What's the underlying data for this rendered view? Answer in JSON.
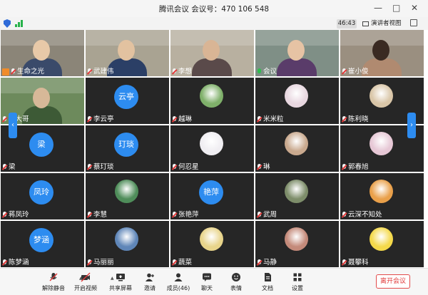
{
  "window": {
    "title": "腾讯会议 会议号：470 106 548",
    "minimize": "—",
    "maximize": "□",
    "close": "✕"
  },
  "infobar": {
    "timer": "46:43",
    "speaker_view": "演讲者视图"
  },
  "participants": [
    {
      "name": "生命之光",
      "kind": "video",
      "mic": "muted",
      "host": true
    },
    {
      "name": "武建伟",
      "kind": "video",
      "mic": "muted"
    },
    {
      "name": "李想",
      "kind": "video",
      "mic": "muted"
    },
    {
      "name": "会议",
      "kind": "video",
      "mic": "on"
    },
    {
      "name": "崔小俊",
      "kind": "video",
      "mic": "muted"
    },
    {
      "name": "田大哥",
      "kind": "video",
      "mic": "muted"
    },
    {
      "name": "李云亭",
      "kind": "text",
      "avatar_text": "云亭",
      "mic": "muted"
    },
    {
      "name": "越琳",
      "kind": "image",
      "mic": "muted"
    },
    {
      "name": "米米粒",
      "kind": "image",
      "mic": "muted"
    },
    {
      "name": "陈利晓",
      "kind": "image",
      "mic": "muted"
    },
    {
      "name": "梁",
      "kind": "text",
      "avatar_text": "梁",
      "mic": "muted"
    },
    {
      "name": "蔡玎琰",
      "kind": "text",
      "avatar_text": "玎琰",
      "mic": "muted"
    },
    {
      "name": "何忍星",
      "kind": "image",
      "mic": "muted"
    },
    {
      "name": "琳",
      "kind": "image",
      "mic": "muted"
    },
    {
      "name": "郭春旭",
      "kind": "image",
      "mic": "muted"
    },
    {
      "name": "蒋凤玲",
      "kind": "text",
      "avatar_text": "凤玲",
      "mic": "muted"
    },
    {
      "name": "李慧",
      "kind": "image",
      "mic": "muted"
    },
    {
      "name": "张艳萍",
      "kind": "text",
      "avatar_text": "艳萍",
      "mic": "muted"
    },
    {
      "name": "武周",
      "kind": "image",
      "mic": "muted"
    },
    {
      "name": "云深不知处",
      "kind": "image",
      "mic": "muted"
    },
    {
      "name": "陈梦涵",
      "kind": "text",
      "avatar_text": "梦涵",
      "mic": "muted"
    },
    {
      "name": "马丽丽",
      "kind": "image",
      "mic": "muted"
    },
    {
      "name": "蔬菜",
      "kind": "image",
      "mic": "muted"
    },
    {
      "name": "马静",
      "kind": "image",
      "mic": "muted"
    },
    {
      "name": "聂攀科",
      "kind": "image",
      "mic": "muted"
    }
  ],
  "pager": {
    "prev": "‹",
    "next": "›"
  },
  "toolbar": {
    "items": [
      {
        "label": "解除静音",
        "icon": "mic-muted-icon"
      },
      {
        "label": "开启视频",
        "icon": "camera-off-icon"
      },
      {
        "label": "共享屏幕",
        "icon": "share-screen-icon"
      },
      {
        "label": "邀请",
        "icon": "invite-icon"
      },
      {
        "label": "成员(46)",
        "icon": "members-icon"
      },
      {
        "label": "聊天",
        "icon": "chat-icon"
      },
      {
        "label": "表情",
        "icon": "emoji-icon"
      },
      {
        "label": "文档",
        "icon": "document-icon"
      },
      {
        "label": "设置",
        "icon": "settings-icon"
      }
    ],
    "leave": "离开会议"
  },
  "colors": {
    "accent": "#2d8cf0",
    "tile_bg": "#262626",
    "danger": "#e03a3a",
    "signal": "#27b24a"
  }
}
